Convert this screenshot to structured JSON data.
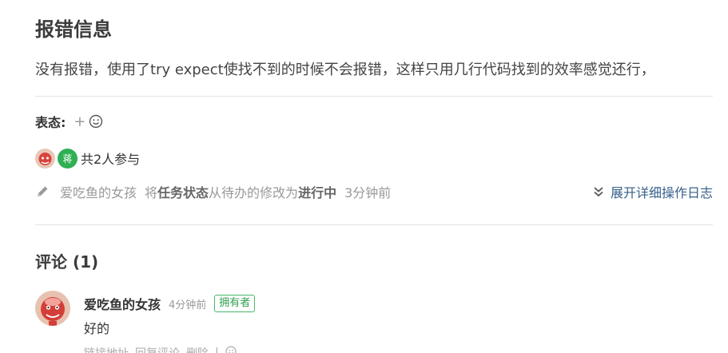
{
  "error_section": {
    "title": "报错信息",
    "content": "没有报错，使用了try expect使找不到的时候不会报错，这样只用几行代码找到的效率感觉还行，"
  },
  "reactions": {
    "label": "表态:",
    "add_symbol": "+"
  },
  "participants": {
    "avatar_letter": "蒋",
    "count_text": "共2人参与"
  },
  "activity": {
    "user": "爱吃鱼的女孩",
    "action_prefix": "将",
    "field": "任务状态",
    "action_mid": "从待办的修改为",
    "new_status": "进行中",
    "time": "3分钟前",
    "expand_label": "展开详细操作日志"
  },
  "comments": {
    "title": "评论 (1)",
    "items": [
      {
        "author": "爱吃鱼的女孩",
        "time": "4分钟前",
        "badge": "拥有者",
        "body": "好的",
        "actions": [
          "链接地址",
          "回复评论",
          "删除",
          "|"
        ]
      }
    ]
  },
  "colors": {
    "accent_green": "#2fb054",
    "link_blue": "#37608a",
    "muted": "#999999"
  }
}
